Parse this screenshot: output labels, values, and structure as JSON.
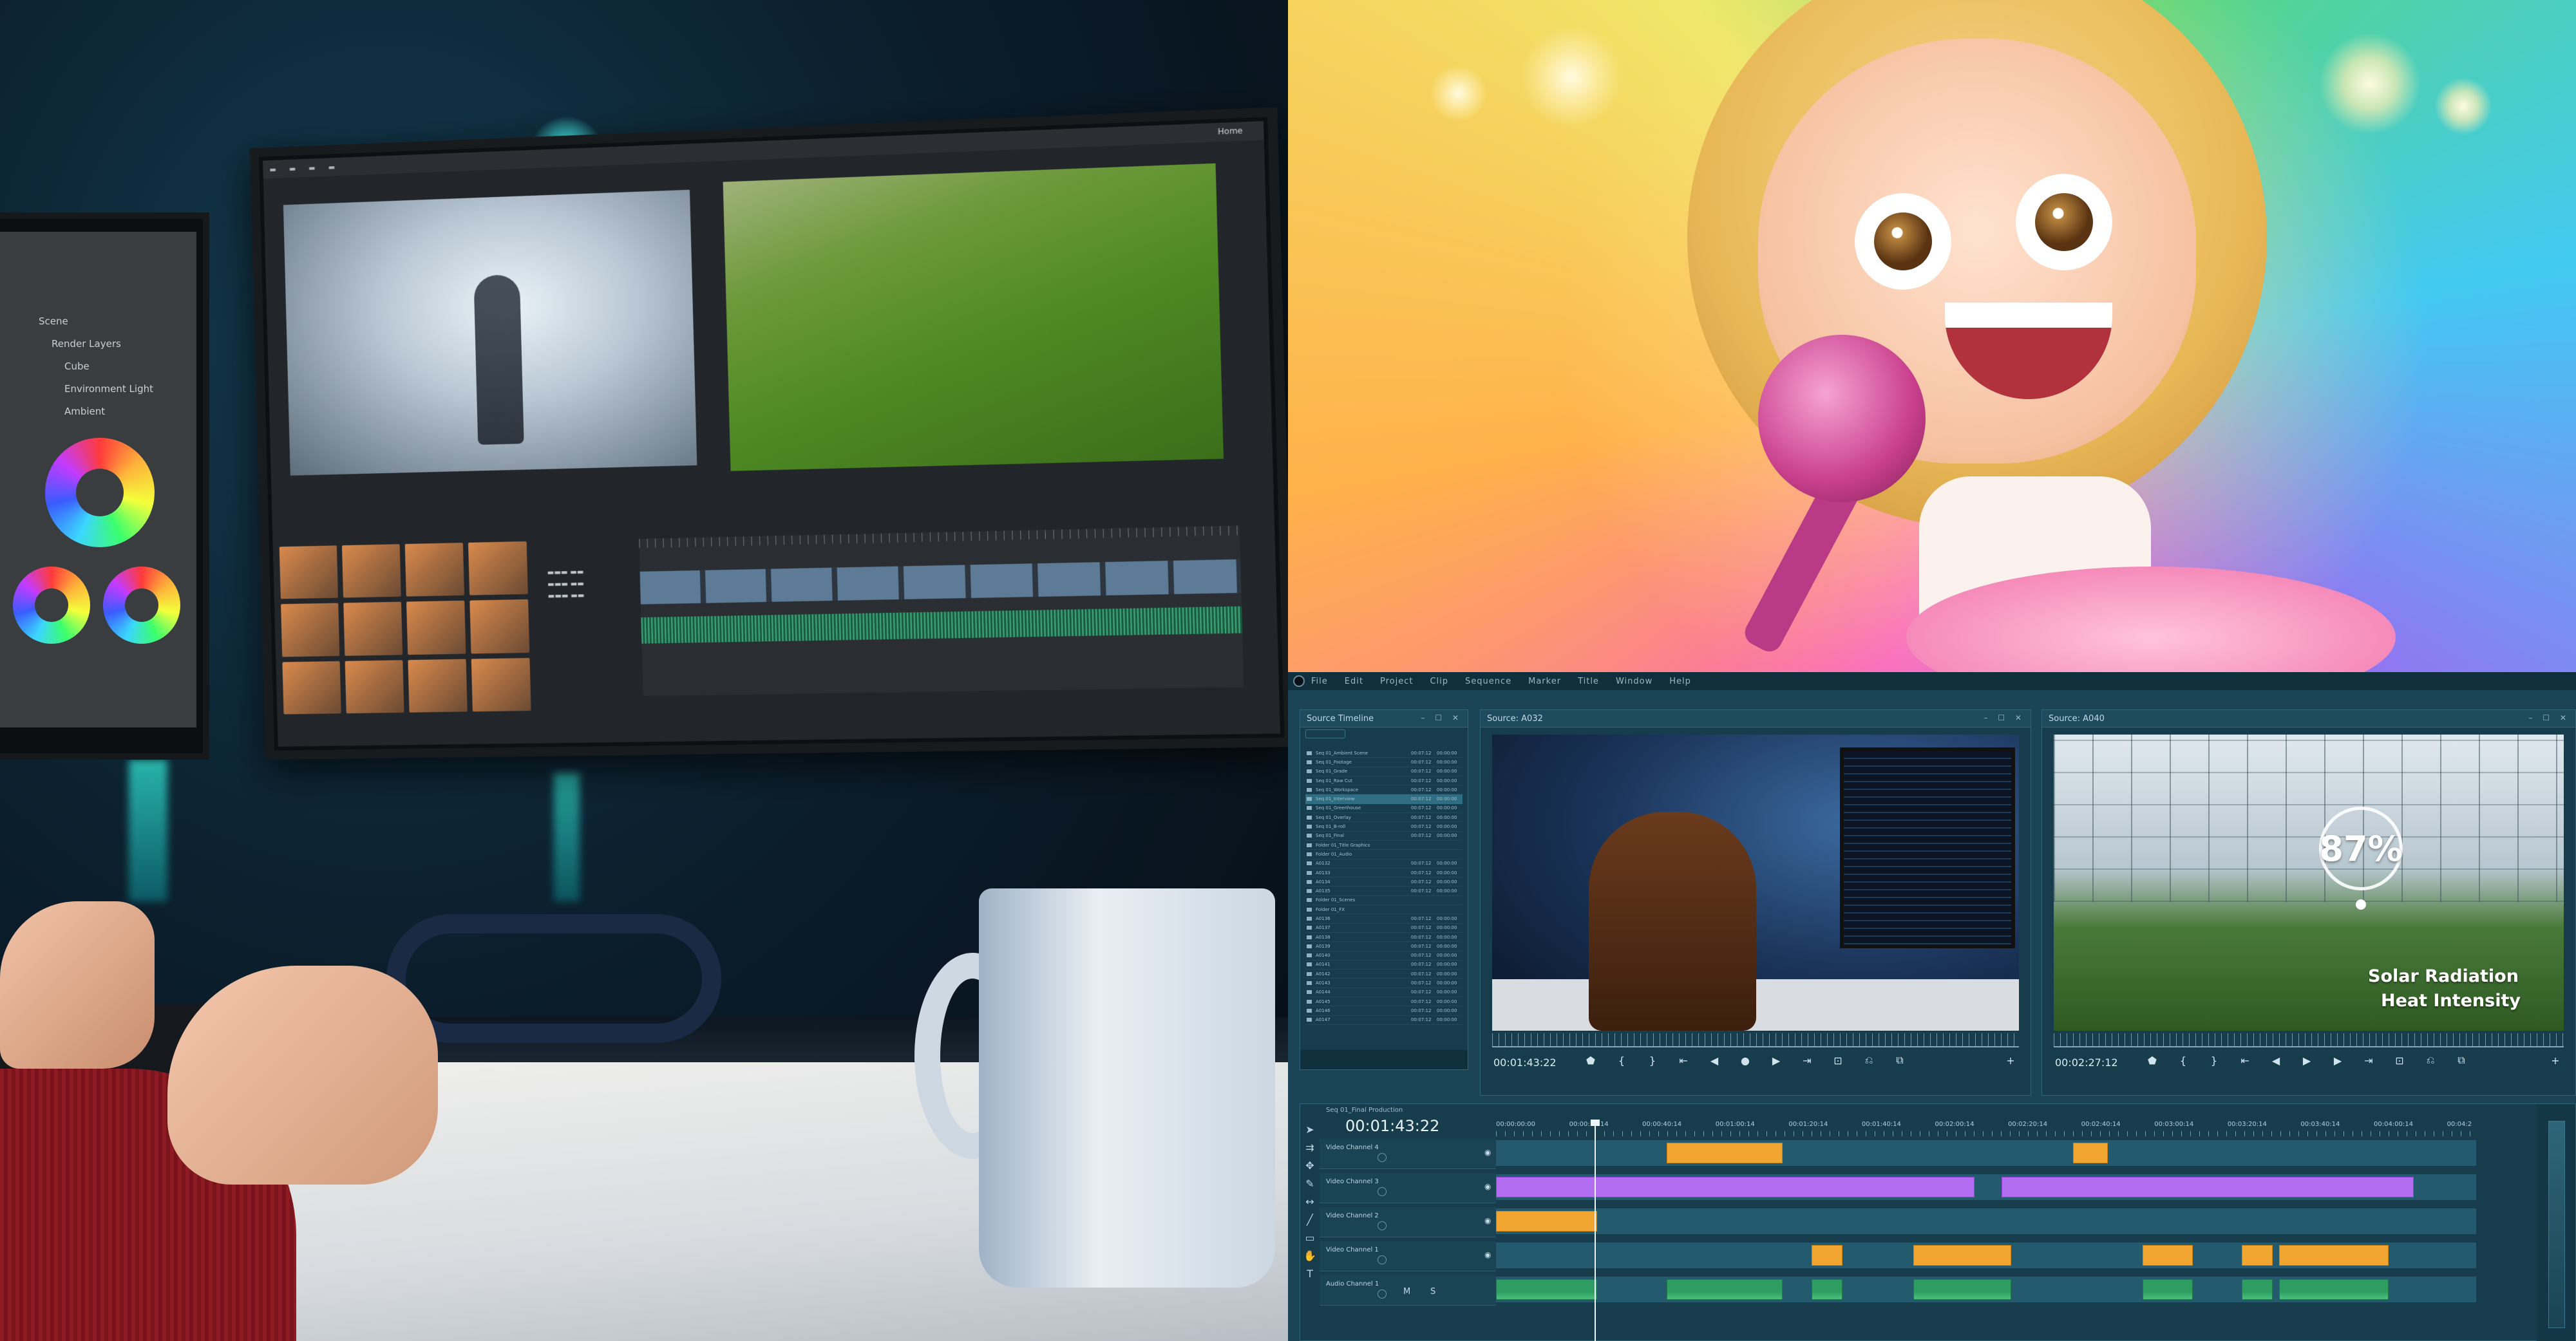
{
  "left_monitor": {
    "side_labels": [
      "Scene",
      "Render Layers",
      "Cube",
      "Environment Light",
      "Ambient"
    ],
    "home_label": "Home"
  },
  "app": {
    "menu": [
      "File",
      "Edit",
      "Project",
      "Clip",
      "Sequence",
      "Marker",
      "Title",
      "Window",
      "Help"
    ],
    "bin": {
      "title": "Source Timeline",
      "rows": [
        {
          "name": "Seq 01_Ambient Scene",
          "dur": "00:07:12",
          "tc": "00:00:00"
        },
        {
          "name": "Seq 01_Footage",
          "dur": "00:07:12",
          "tc": "00:00:00"
        },
        {
          "name": "Seq 01_Grade",
          "dur": "00:07:12",
          "tc": "00:00:00"
        },
        {
          "name": "Seq 01_Raw Cut",
          "dur": "00:07:12",
          "tc": "00:00:00"
        },
        {
          "name": "Seq 01_Workspace",
          "dur": "00:07:12",
          "tc": "00:00:00"
        },
        {
          "name": "Seq 01_Interview",
          "dur": "00:07:12",
          "tc": "00:00:00"
        },
        {
          "name": "Seq 01_Greenhouse",
          "dur": "00:07:12",
          "tc": "00:00:00"
        },
        {
          "name": "Seq 01_Overlay",
          "dur": "00:07:12",
          "tc": "00:00:00"
        },
        {
          "name": "Seq 01_B-roll",
          "dur": "00:07:12",
          "tc": "00:00:00"
        },
        {
          "name": "Seq 01_Final",
          "dur": "00:07:12",
          "tc": "00:00:00"
        },
        {
          "name": "Folder 01_Title Graphics",
          "dur": "",
          "tc": ""
        },
        {
          "name": "Folder 01_Audio",
          "dur": "",
          "tc": ""
        },
        {
          "name": "A0132",
          "dur": "00:07:12",
          "tc": "00:00:00"
        },
        {
          "name": "A0133",
          "dur": "00:07:12",
          "tc": "00:00:00"
        },
        {
          "name": "A0134",
          "dur": "00:07:12",
          "tc": "00:00:00"
        },
        {
          "name": "A0135",
          "dur": "00:07:12",
          "tc": "00:00:00"
        },
        {
          "name": "Folder 01_Scenes",
          "dur": "",
          "tc": ""
        },
        {
          "name": "Folder 01_FX",
          "dur": "",
          "tc": ""
        },
        {
          "name": "A0136",
          "dur": "00:07:12",
          "tc": "00:00:00"
        },
        {
          "name": "A0137",
          "dur": "00:07:12",
          "tc": "00:00:00"
        },
        {
          "name": "A0138",
          "dur": "00:07:12",
          "tc": "00:00:00"
        },
        {
          "name": "A0139",
          "dur": "00:07:12",
          "tc": "00:00:00"
        },
        {
          "name": "A0140",
          "dur": "00:07:12",
          "tc": "00:00:00"
        },
        {
          "name": "A0141",
          "dur": "00:07:12",
          "tc": "00:00:00"
        },
        {
          "name": "A0142",
          "dur": "00:07:12",
          "tc": "00:00:00"
        },
        {
          "name": "A0143",
          "dur": "00:07:12",
          "tc": "00:00:00"
        },
        {
          "name": "A0144",
          "dur": "00:07:12",
          "tc": "00:00:00"
        },
        {
          "name": "A0145",
          "dur": "00:07:12",
          "tc": "00:00:00"
        },
        {
          "name": "A0146",
          "dur": "00:07:12",
          "tc": "00:00:00"
        },
        {
          "name": "A0147",
          "dur": "00:07:12",
          "tc": "00:00:00"
        }
      ]
    },
    "source_a": {
      "title": "Source: A032",
      "timecode": "00:01:43:22"
    },
    "source_b": {
      "title": "Source: A040",
      "timecode": "00:02:27:12",
      "gauge_value": "87%",
      "overlay_line1": "Solar Radiation",
      "overlay_line2": "Heat Intensity"
    },
    "transport_icons": [
      "marker-icon",
      "in-point-icon",
      "out-point-icon",
      "go-to-in-icon",
      "step-back-icon",
      "play-icon",
      "step-forward-icon",
      "go-to-out-icon",
      "insert-icon",
      "overwrite-icon",
      "export-frame-icon",
      "add-icon"
    ],
    "timeline": {
      "sequence_label": "Seq 01_Final Production",
      "timecode": "00:01:43:22",
      "ruler": [
        "00:00:00:00",
        "00:00:20:14",
        "00:00:40:14",
        "00:01:00:14",
        "00:01:20:14",
        "00:01:40:14",
        "00:02:00:14",
        "00:02:20:14",
        "00:02:40:14",
        "00:03:00:14",
        "00:03:20:14",
        "00:03:40:14",
        "00:04:00:14",
        "00:04:2"
      ],
      "tracks": [
        {
          "name": "Video Channel 4",
          "type": "video"
        },
        {
          "name": "Video Channel 3",
          "type": "video"
        },
        {
          "name": "Video Channel 2",
          "type": "video"
        },
        {
          "name": "Video Channel 1",
          "type": "video"
        },
        {
          "name": "Audio Channel 1",
          "type": "audio",
          "mute": "M",
          "solo": "S"
        }
      ],
      "colors": {
        "orange_clip": "#f1a632",
        "purple_clip": "#b26cf0",
        "green_clip": "#2f9c61"
      }
    }
  }
}
